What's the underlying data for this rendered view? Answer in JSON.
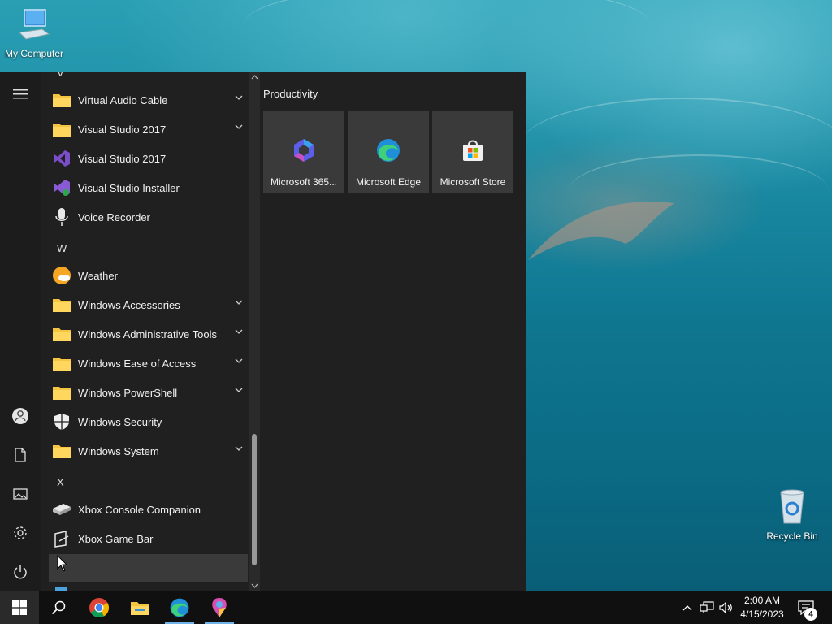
{
  "desktop": {
    "icons": [
      {
        "label": "My Computer",
        "icon": "computer-icon"
      },
      {
        "label": "Recycle Bin",
        "icon": "recycle-bin-icon"
      }
    ]
  },
  "start_menu": {
    "rail": [
      {
        "name": "menu-icon"
      },
      {
        "name": "user-icon"
      },
      {
        "name": "documents-icon"
      },
      {
        "name": "pictures-icon"
      },
      {
        "name": "settings-icon"
      },
      {
        "name": "power-icon"
      }
    ],
    "apps": [
      {
        "label": "V",
        "type": "letter"
      },
      {
        "label": "Virtual Audio Cable",
        "icon": "folder-icon",
        "expandable": true
      },
      {
        "label": "Visual Studio 2017",
        "icon": "folder-icon",
        "expandable": true
      },
      {
        "label": "Visual Studio 2017",
        "icon": "visual-studio-icon"
      },
      {
        "label": "Visual Studio Installer",
        "icon": "visual-studio-installer-icon"
      },
      {
        "label": "Voice Recorder",
        "icon": "microphone-icon"
      },
      {
        "label": "W",
        "type": "letter"
      },
      {
        "label": "Weather",
        "icon": "weather-icon"
      },
      {
        "label": "Windows Accessories",
        "icon": "folder-icon",
        "expandable": true
      },
      {
        "label": "Windows Administrative Tools",
        "icon": "folder-icon",
        "expandable": true
      },
      {
        "label": "Windows Ease of Access",
        "icon": "folder-icon",
        "expandable": true
      },
      {
        "label": "Windows PowerShell",
        "icon": "folder-icon",
        "expandable": true
      },
      {
        "label": "Windows Security",
        "icon": "shield-icon"
      },
      {
        "label": "Windows System",
        "icon": "folder-icon",
        "expandable": true
      },
      {
        "label": "X",
        "type": "letter"
      },
      {
        "label": "Xbox Console Companion",
        "icon": "xbox-console-icon"
      },
      {
        "label": "Xbox Game Bar",
        "icon": "xbox-game-bar-icon"
      }
    ],
    "tiles_group": "Productivity",
    "tiles": [
      {
        "label": "Microsoft 365...",
        "icon": "microsoft-365-icon"
      },
      {
        "label": "Microsoft Edge",
        "icon": "edge-icon"
      },
      {
        "label": "Microsoft Store",
        "icon": "store-icon"
      }
    ]
  },
  "taskbar": {
    "pinned": [
      {
        "name": "start-button",
        "icon": "windows-icon"
      },
      {
        "name": "search-button",
        "icon": "search-icon"
      },
      {
        "name": "chrome-button",
        "icon": "chrome-icon"
      },
      {
        "name": "file-explorer-button",
        "icon": "folder-icon"
      },
      {
        "name": "edge-button",
        "icon": "edge-icon"
      },
      {
        "name": "paint-button",
        "icon": "paint-icon"
      }
    ],
    "clock": {
      "time": "2:00 AM",
      "date": "4/15/2023"
    },
    "notification_count": "4"
  },
  "colors": {
    "menu_bg": "#202020",
    "tile_bg": "#3a3a3a",
    "taskbar_bg": "#101010",
    "accent": "#6fb3e8"
  }
}
